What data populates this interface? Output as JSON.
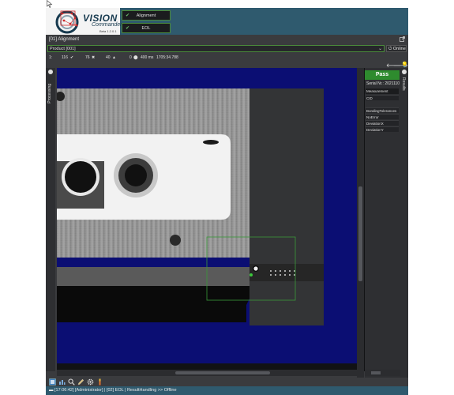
{
  "header": {
    "logo_title": "VISION",
    "logo_subtitle": "Commander",
    "logo_version": "Beta  1.2.0.1",
    "steps": [
      {
        "label": "Alignment",
        "status": "ok"
      },
      {
        "label": "EOL",
        "status": "ok"
      }
    ]
  },
  "panel": {
    "title": "[01] Alignment"
  },
  "product": {
    "selected": "Product [001]",
    "online_label": "Online"
  },
  "stats": {
    "index": "1:",
    "ok_count": "116",
    "error_count": "76",
    "warning_count": "40",
    "zero_count": "0",
    "cycle_time": "400 ms",
    "timestamp": "1705:34.788"
  },
  "left_strip": {
    "label": "Processing"
  },
  "right_strip": {
    "label": "Results"
  },
  "results": {
    "status": "Pass",
    "serial_label": "Serial Nr.:",
    "serial_value": "2021110",
    "measurement_header": "Measurement",
    "rows": [
      {
        "label": "CID"
      },
      {
        "label": "BondingTolerances"
      },
      {
        "label": "NoError"
      },
      {
        "label": "DeviationX"
      },
      {
        "label": "DeviationY"
      }
    ]
  },
  "status_bar": {
    "text": "[17:06:42] [Administrator] | [02] EOL | ResultHandling >> Offline"
  },
  "colors": {
    "header": "#2f5a6e",
    "pass": "#2e8b2e",
    "viewer_bg": "#0b0e73",
    "roi": "#3a9a3a"
  },
  "icons": {
    "popout": "popout-icon",
    "online": "power-icon",
    "back": "arrow-left-icon",
    "forward": "arrow-right-icon",
    "idea": "lightbulb-icon"
  }
}
